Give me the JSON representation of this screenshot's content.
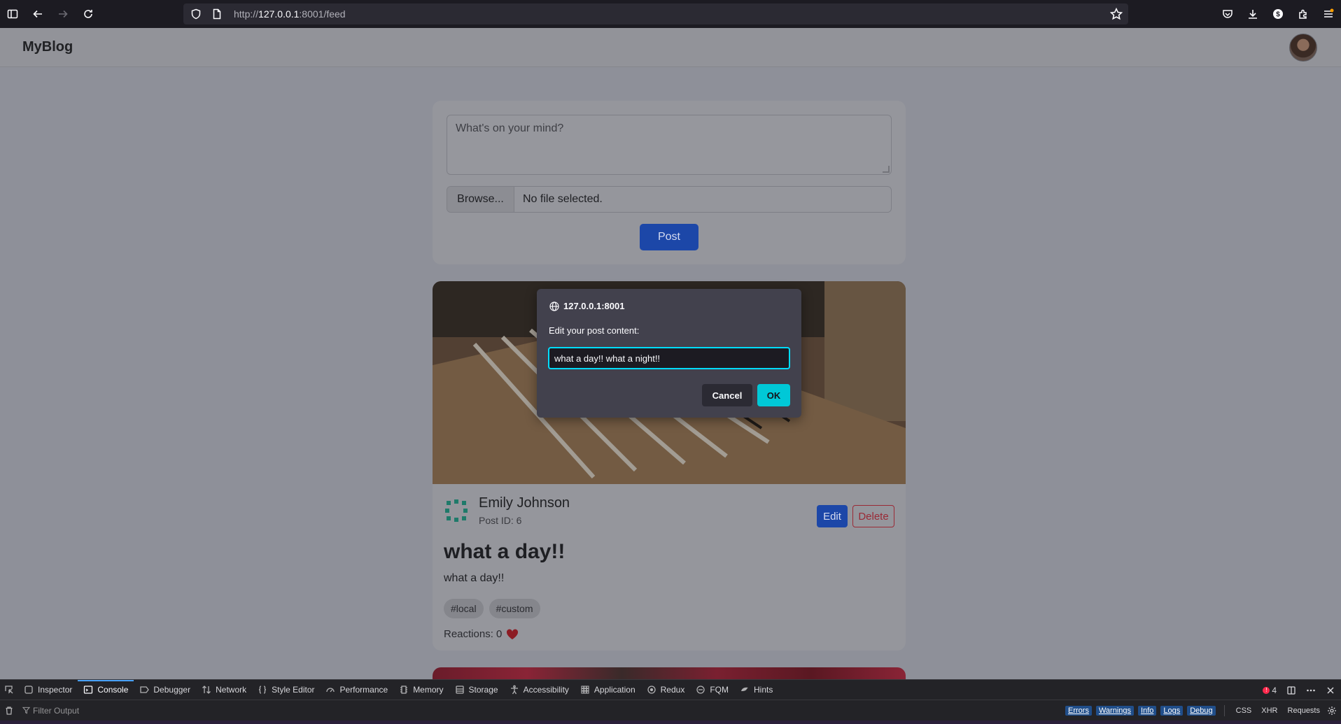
{
  "browser": {
    "url_prefix": "http://",
    "url_host": "127.0.0.1",
    "url_rest": ":8001/feed"
  },
  "app": {
    "brand": "MyBlog"
  },
  "composer": {
    "placeholder": "What's on your mind?",
    "browse_label": "Browse...",
    "file_status": "No file selected.",
    "post_label": "Post"
  },
  "post": {
    "author": "Emily Johnson",
    "post_id": "Post ID: 6",
    "edit_label": "Edit",
    "delete_label": "Delete",
    "title": "what a day!!",
    "body": "what a day!!",
    "tags": [
      "#local",
      "#custom"
    ],
    "reactions": "Reactions: 0"
  },
  "modal": {
    "origin": "127.0.0.1:8001",
    "message": "Edit your post content:",
    "input_value": "what a day!! what a night!!",
    "cancel_label": "Cancel",
    "ok_label": "OK"
  },
  "devtools": {
    "tabs": [
      "Inspector",
      "Console",
      "Debugger",
      "Network",
      "Style Editor",
      "Performance",
      "Memory",
      "Storage",
      "Accessibility",
      "Application",
      "Redux",
      "FQM",
      "Hints"
    ],
    "active_tab": "Console",
    "error_count": "4",
    "filter_placeholder": "Filter Output",
    "filters": [
      "Errors",
      "Warnings",
      "Info",
      "Logs",
      "Debug"
    ],
    "extra_filters": [
      "CSS",
      "XHR",
      "Requests"
    ]
  },
  "colors": {
    "accent": "#1c47a8",
    "danger": "#9a2a36",
    "modal_ok": "#00c8d7"
  }
}
